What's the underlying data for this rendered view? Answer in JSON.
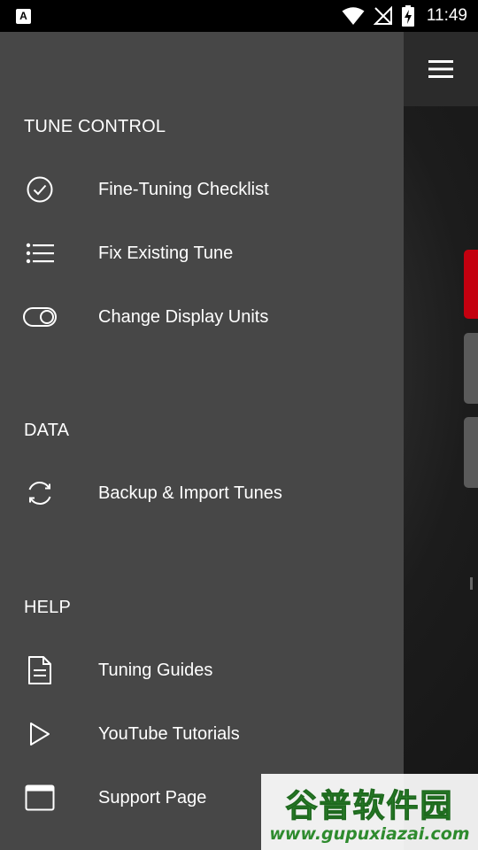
{
  "status_bar": {
    "notification_icon_letter": "A",
    "time": "11:49"
  },
  "drawer": {
    "sections": [
      {
        "header": "TUNE CONTROL",
        "items": [
          {
            "label": "Fine-Tuning Checklist",
            "icon": "check-circle-icon"
          },
          {
            "label": "Fix Existing Tune",
            "icon": "list-icon"
          },
          {
            "label": "Change Display Units",
            "icon": "toggle-icon"
          }
        ]
      },
      {
        "header": "DATA",
        "items": [
          {
            "label": "Backup & Import Tunes",
            "icon": "sync-icon"
          }
        ]
      },
      {
        "header": "HELP",
        "items": [
          {
            "label": "Tuning Guides",
            "icon": "document-icon"
          },
          {
            "label": "YouTube Tutorials",
            "icon": "play-icon"
          },
          {
            "label": "Support Page",
            "icon": "browser-window-icon"
          }
        ]
      }
    ]
  },
  "colors": {
    "drawer_bg": "#474747",
    "accent_red": "#c4000f",
    "watermark_green": "#2e8b2e"
  },
  "watermark": {
    "main": "谷普软件园",
    "url": "www.gupuxiazai.com"
  }
}
